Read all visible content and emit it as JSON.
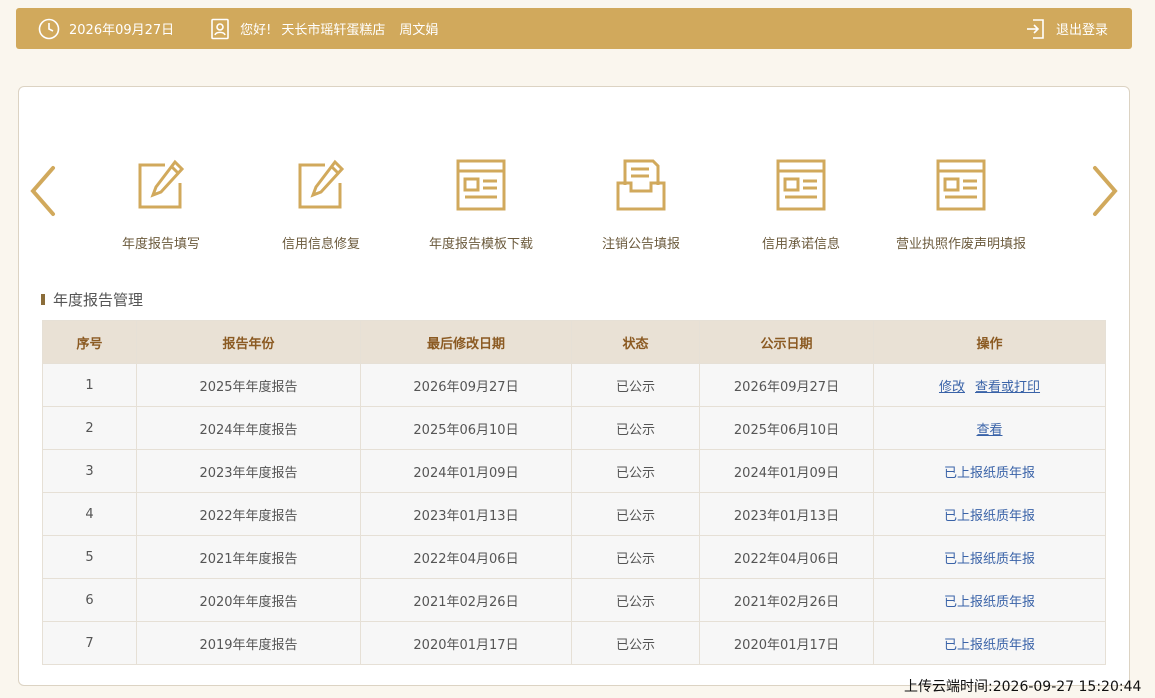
{
  "header": {
    "date": "2026年09月27日",
    "greeting": "您好!",
    "shop_name": "天长市瑶轩蛋糕店",
    "user_name": "周文娟",
    "logout": "退出登录"
  },
  "colors": {
    "accent": "#d1a95c",
    "header_text": "#8b5a22",
    "link": "#3a63a8"
  },
  "menu": [
    {
      "label": "年度报告填写",
      "icon": "edit-icon"
    },
    {
      "label": "信用信息修复",
      "icon": "edit-icon"
    },
    {
      "label": "年度报告模板下载",
      "icon": "document-icon"
    },
    {
      "label": "注销公告填报",
      "icon": "inbox-icon"
    },
    {
      "label": "信用承诺信息",
      "icon": "document-icon"
    },
    {
      "label": "营业执照作废声明填报",
      "icon": "document-icon"
    }
  ],
  "section_title": "年度报告管理",
  "table": {
    "headers": [
      "序号",
      "报告年份",
      "最后修改日期",
      "状态",
      "公示日期",
      "操作"
    ],
    "rows": [
      {
        "no": "1",
        "year": "2025年年度报告",
        "modified": "2026年09月27日",
        "status": "已公示",
        "published": "2026年09月27日",
        "action_edit": "修改",
        "action_view": "查看或打印"
      },
      {
        "no": "2",
        "year": "2024年年度报告",
        "modified": "2025年06月10日",
        "status": "已公示",
        "published": "2025年06月10日",
        "action_view": "查看"
      },
      {
        "no": "3",
        "year": "2023年年度报告",
        "modified": "2024年01月09日",
        "status": "已公示",
        "published": "2024年01月09日",
        "action_paper": "已上报纸质年报"
      },
      {
        "no": "4",
        "year": "2022年年度报告",
        "modified": "2023年01月13日",
        "status": "已公示",
        "published": "2023年01月13日",
        "action_paper": "已上报纸质年报"
      },
      {
        "no": "5",
        "year": "2021年年度报告",
        "modified": "2022年04月06日",
        "status": "已公示",
        "published": "2022年04月06日",
        "action_paper": "已上报纸质年报"
      },
      {
        "no": "6",
        "year": "2020年年度报告",
        "modified": "2021年02月26日",
        "status": "已公示",
        "published": "2021年02月26日",
        "action_paper": "已上报纸质年报"
      },
      {
        "no": "7",
        "year": "2019年年度报告",
        "modified": "2020年01月17日",
        "status": "已公示",
        "published": "2020年01月17日",
        "action_paper": "已上报纸质年报"
      }
    ]
  },
  "footer_time": "上传云端时间:2026-09-27 15:20:44"
}
